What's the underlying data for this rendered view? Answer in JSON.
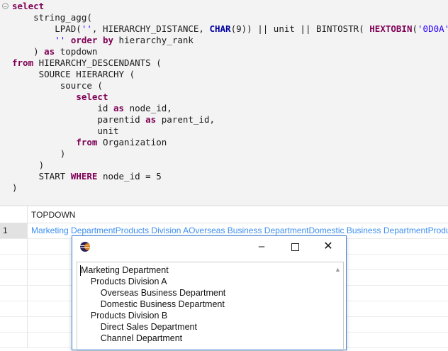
{
  "editor": {
    "lines": [
      [
        [
          "kw",
          "select"
        ]
      ],
      [
        [
          "t",
          "    string_agg("
        ]
      ],
      [
        [
          "t",
          "        LPAD("
        ],
        [
          "str",
          "''"
        ],
        [
          "t",
          ", HIERARCHY_DISTANCE, "
        ],
        [
          "fb",
          "CHAR"
        ],
        [
          "t",
          "(9)) || unit || BINTOSTR( "
        ],
        [
          "fn",
          "HEXTOBIN"
        ],
        [
          "t",
          "("
        ],
        [
          "str",
          "'0D0A'"
        ],
        [
          "t",
          "))"
        ],
        [
          "t",
          ","
        ]
      ],
      [
        [
          "t",
          "        "
        ],
        [
          "str",
          "''"
        ],
        [
          "t",
          " "
        ],
        [
          "kw",
          "order by"
        ],
        [
          "t",
          " hierarchy_rank"
        ]
      ],
      [
        [
          "t",
          "    ) "
        ],
        [
          "kw",
          "as"
        ],
        [
          "t",
          " topdown"
        ]
      ],
      [
        [
          "kw",
          "from"
        ],
        [
          "t",
          " HIERARCHY_DESCENDANTS ("
        ]
      ],
      [
        [
          "t",
          "     SOURCE HIERARCHY ("
        ]
      ],
      [
        [
          "t",
          "         source ("
        ]
      ],
      [
        [
          "t",
          "            "
        ],
        [
          "kw",
          "select"
        ]
      ],
      [
        [
          "t",
          "                id "
        ],
        [
          "kw",
          "as"
        ],
        [
          "t",
          " node_id,"
        ]
      ],
      [
        [
          "t",
          "                parentid "
        ],
        [
          "kw",
          "as"
        ],
        [
          "t",
          " parent_id,"
        ]
      ],
      [
        [
          "t",
          "                unit"
        ]
      ],
      [
        [
          "t",
          "            "
        ],
        [
          "kw",
          "from"
        ],
        [
          "t",
          " Organization"
        ]
      ],
      [
        [
          "t",
          "         )"
        ]
      ],
      [
        [
          "t",
          "     )"
        ]
      ],
      [
        [
          "t",
          "     START "
        ],
        [
          "kw",
          "WHERE"
        ],
        [
          "t",
          " node_id = 5"
        ]
      ],
      [
        [
          "t",
          ")"
        ]
      ]
    ]
  },
  "results": {
    "column_header": "TOPDOWN",
    "row_number": "1",
    "cell_value": "Marketing DepartmentProducts Division AOverseas Business DepartmentDomestic Business DepartmentProducts Division BDirect Sales DepartmentChannel Department"
  },
  "dialog": {
    "minimize_label": "–",
    "close_label": "✕",
    "tree_text": "Marketing Department\n    Products Division A\n        Overseas Business Department\n        Domestic Business Department\n    Products Division B\n        Direct Sales Department\n        Channel Department"
  }
}
